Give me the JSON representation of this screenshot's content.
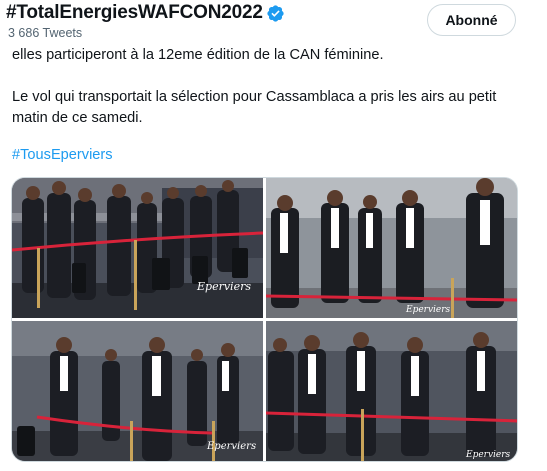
{
  "header": {
    "title": "#TotalEnergiesWAFCON2022",
    "tweet_count": "3 686 Tweets",
    "follow_label": "Abonné"
  },
  "tweet": {
    "line1": "elles participeront à la 12eme édition de la CAN féminine.",
    "line2": "Le vol qui transportait la sélection pour Cassamblaca a pris les airs  au petit matin de ce samedi.",
    "hashtag": "#TousEperviers"
  },
  "media": {
    "watermark": "Eperviers",
    "photos": [
      "photo-queue-1",
      "photo-queue-2",
      "photo-queue-3",
      "photo-queue-4"
    ]
  },
  "colors": {
    "verified": "#1d9bf0",
    "link": "#1d9bf0",
    "muted": "#536471",
    "rope": "#d8233a"
  }
}
